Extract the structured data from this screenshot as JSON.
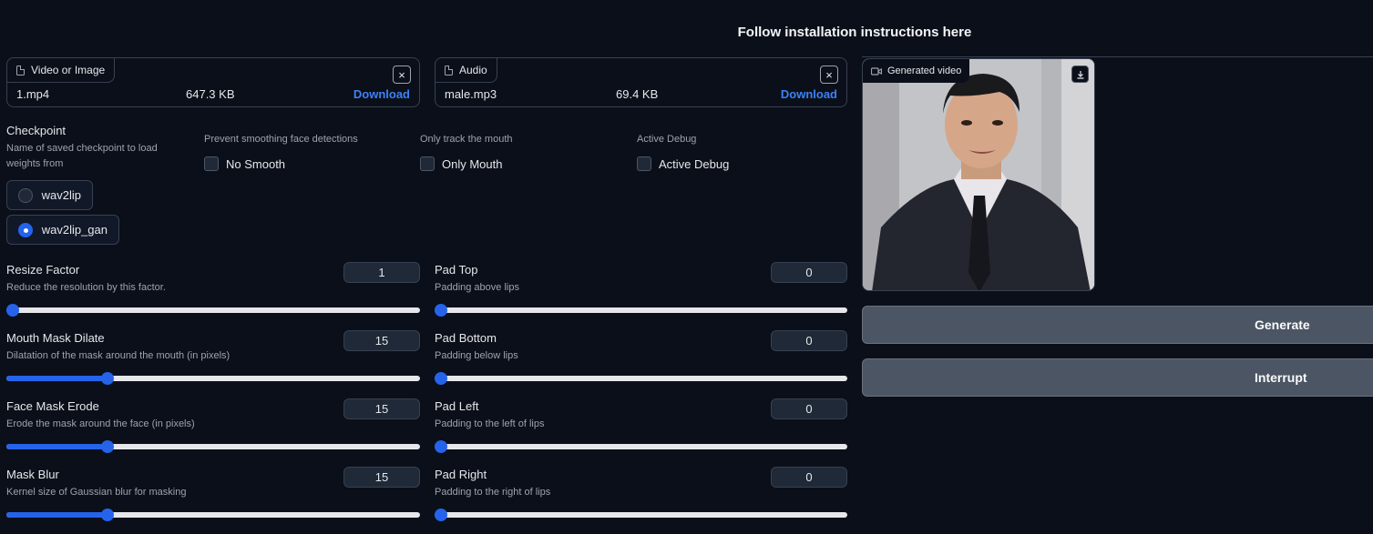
{
  "header": {
    "link_text": "Follow installation instructions here"
  },
  "video_input": {
    "tag": "Video or Image",
    "file_name": "1.mp4",
    "file_size": "647.3 KB",
    "download": "Download",
    "close": "×"
  },
  "audio_input": {
    "tag": "Audio",
    "file_name": "male.mp3",
    "file_size": "69.4 KB",
    "download": "Download",
    "close": "×"
  },
  "checkpoint": {
    "label": "Checkpoint",
    "info_line1": "Name of saved checkpoint to load",
    "info_line2": "weights from",
    "options": [
      "wav2lip",
      "wav2lip_gan"
    ],
    "selected": "wav2lip_gan"
  },
  "no_smooth": {
    "info": "Prevent smoothing face detections",
    "label": "No Smooth",
    "checked": false
  },
  "only_mouth": {
    "info": "Only track the mouth",
    "label": "Only Mouth",
    "checked": false
  },
  "active_debug": {
    "info": "Active Debug",
    "label": "Active Debug",
    "checked": false
  },
  "sliders_left": [
    {
      "label": "Resize Factor",
      "info": "Reduce the resolution by this factor.",
      "value": "1",
      "fraction": 0.0
    },
    {
      "label": "Mouth Mask Dilate",
      "info": "Dilatation of the mask around the mouth (in pixels)",
      "value": "15",
      "fraction": 0.245
    },
    {
      "label": "Face Mask Erode",
      "info": "Erode the mask around the face (in pixels)",
      "value": "15",
      "fraction": 0.245
    },
    {
      "label": "Mask Blur",
      "info": "Kernel size of Gaussian blur for masking",
      "value": "15",
      "fraction": 0.245
    }
  ],
  "sliders_right": [
    {
      "label": "Pad Top",
      "info": "Padding above lips",
      "value": "0",
      "fraction": 0.0
    },
    {
      "label": "Pad Bottom",
      "info": "Padding below lips",
      "value": "0",
      "fraction": 0.0
    },
    {
      "label": "Pad Left",
      "info": "Padding to the left of lips",
      "value": "0",
      "fraction": 0.0
    },
    {
      "label": "Pad Right",
      "info": "Padding to the right of lips",
      "value": "0",
      "fraction": 0.0
    }
  ],
  "output": {
    "tag": "Generated video",
    "download_icon": "download-icon"
  },
  "buttons": {
    "generate": "Generate",
    "interrupt": "Interrupt"
  },
  "colors": {
    "background": "#0b0f19",
    "accent": "#2563eb",
    "link": "#3b82f6",
    "button": "#4b5563"
  }
}
